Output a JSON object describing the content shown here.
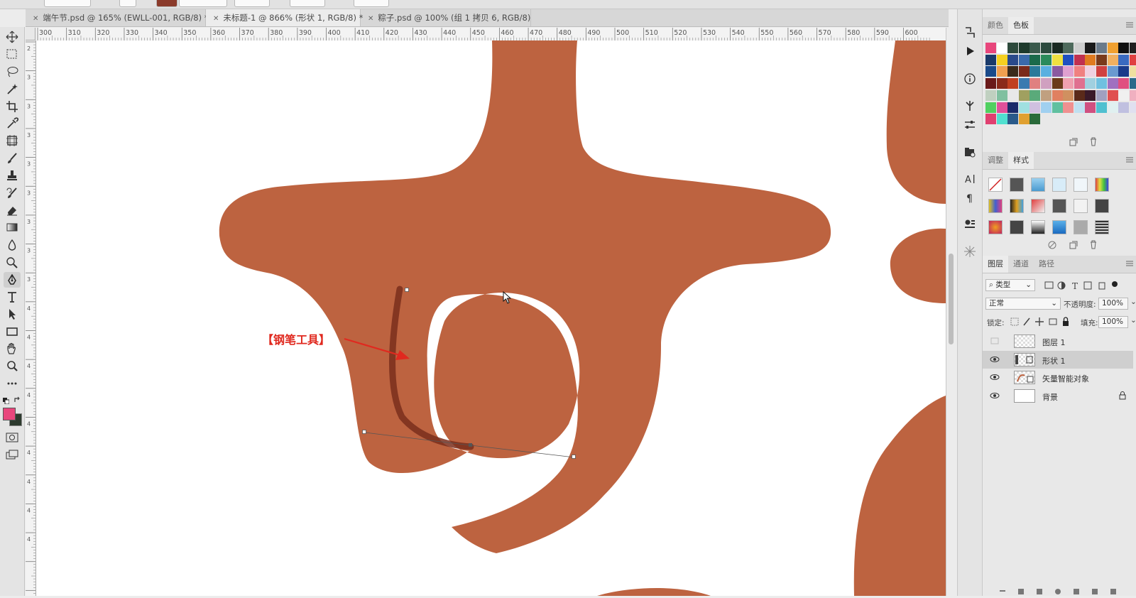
{
  "document_tabs": [
    {
      "label": "端午节.psd @ 165% (EWLL-001, RGB/8) *",
      "active": false
    },
    {
      "label": "未标题-1 @ 866% (形状 1, RGB/8) *",
      "active": true
    },
    {
      "label": "粽子.psd @ 100% (组 1 拷贝 6, RGB/8)",
      "active": false
    }
  ],
  "ruler_top_labels": [
    "300",
    "310",
    "320",
    "330",
    "340",
    "350",
    "360",
    "370",
    "380",
    "390",
    "400",
    "410",
    "420",
    "430",
    "440",
    "450",
    "460",
    "470",
    "480",
    "490",
    "500",
    "510",
    "520",
    "530",
    "540",
    "550",
    "560",
    "570",
    "580",
    "590",
    "600"
  ],
  "ruler_left_labels": [
    "2",
    "3",
    "3",
    "3",
    "3",
    "3",
    "3",
    "3",
    "3",
    "4",
    "4",
    "4",
    "4",
    "4",
    "4",
    "4",
    "4",
    "4"
  ],
  "canvas": {
    "annotation_label": "【钢笔工具】",
    "shape_color": "#bd6340",
    "annotation_color": "#e0291f"
  },
  "tools": [
    "move-tool",
    "marquee-tool",
    "lasso-tool",
    "magic-wand-tool",
    "crop-tool",
    "eyedropper-tool",
    "frame-tool",
    "brush-tool",
    "stamp-tool",
    "history-brush-tool",
    "eraser-tool",
    "gradient-tool",
    "blur-tool",
    "dodge-tool",
    "pen-tool",
    "type-tool",
    "path-selection-tool",
    "rectangle-tool",
    "hand-tool",
    "zoom-tool",
    "more-tools"
  ],
  "colors": {
    "foreground": "#e8467c",
    "background": "#2d3a2e"
  },
  "color_panel": {
    "tabs": [
      "颜色",
      "色板"
    ],
    "active_tab": "色板"
  },
  "swatch_colors": [
    [
      "#e8467c",
      "#ffffff",
      "#2d4a3c",
      "#1e3a2c",
      "#3a5a4c",
      "#2c4a3e",
      "#1a2a22",
      "#4e6a5c",
      "#cfcfcf",
      "#1a1a1a",
      "#6a7a8a",
      "#f0a030",
      "#101010",
      "#202020",
      "#f0f0f0",
      "#0a0a0a"
    ],
    [
      "#1a3a6a",
      "#f5d020",
      "#2a4a8a",
      "#3a6aaa",
      "#1a6a4a",
      "#2a8a5a",
      "#f0e040",
      "#2050c0",
      "#c03050",
      "#e07a20",
      "#7a3a1a",
      "#f0b060",
      "#3a6ac0",
      "#e04040",
      "#a03030",
      "#f07030"
    ],
    [
      "#1a4a8a",
      "#f0a050",
      "#3a2a1a",
      "#7a2a1a",
      "#2a7a9a",
      "#5ab0e0",
      "#8a5aa0",
      "#e0a0d0",
      "#f08080",
      "#f0d0e0",
      "#d04040",
      "#6a9ad0",
      "#1a3a8a",
      "#f0e0a0",
      "#c0c0d0",
      "#f0c070"
    ],
    [
      "#6a1a1a",
      "#8a2a1a",
      "#c04020",
      "#3a7ab0",
      "#e08080",
      "#d0a0c0",
      "#6a3a1a",
      "#f0a0b0",
      "#e07090",
      "#a0d0e0",
      "#70c0e0",
      "#a070c0",
      "#e05080",
      "#2a6a8a",
      "#3a9ae0",
      "#e0509a"
    ],
    [
      "#c0d0c0",
      "#80c0a0",
      "#e8e8e8",
      "#a0a060",
      "#5aaa7a",
      "#c0a080",
      "#e08060",
      "#d09060",
      "#5a2a1a",
      "#3a1a2a",
      "#a0a0c0",
      "#e05050",
      "#f0f0f0",
      "#f0b0c0",
      "#e080c0",
      "#d0a0a0"
    ],
    [
      "#50d060",
      "#e0509a",
      "#1a2a6a",
      "#a0e0e0",
      "#d0c0e0",
      "#a0d0f0",
      "#60c0a0",
      "#f09090",
      "#c0e0f0",
      "#d05080",
      "#50c0d0",
      "#e0f0f0",
      "#c0c0e0",
      "#e0e0f0",
      "#80c0f0",
      "#e0d0d0"
    ],
    [
      "#e04070",
      "#50e0d0",
      "#2a5a8a",
      "#e0a030",
      "#2a6a3a"
    ]
  ],
  "styles_panel": {
    "tabs": [
      "调整",
      "样式"
    ],
    "active_tab": "样式"
  },
  "layers_panel": {
    "tabs": [
      "图层",
      "通道",
      "路径"
    ],
    "active_tab": "图层",
    "filter_label": "类型",
    "blend_mode": "正常",
    "opacity_label": "不透明度:",
    "opacity_value": "100%",
    "lock_label": "锁定:",
    "fill_label": "填充:",
    "fill_value": "100%",
    "layers": [
      {
        "name": "图层 1",
        "visible": false,
        "selected": false,
        "thumb": "checker"
      },
      {
        "name": "形状 1",
        "visible": true,
        "selected": true,
        "thumb": "shape"
      },
      {
        "name": "矢量智能对象",
        "visible": true,
        "selected": false,
        "thumb": "smart"
      },
      {
        "name": "背景",
        "visible": true,
        "selected": false,
        "thumb": "white",
        "locked": true
      }
    ]
  }
}
